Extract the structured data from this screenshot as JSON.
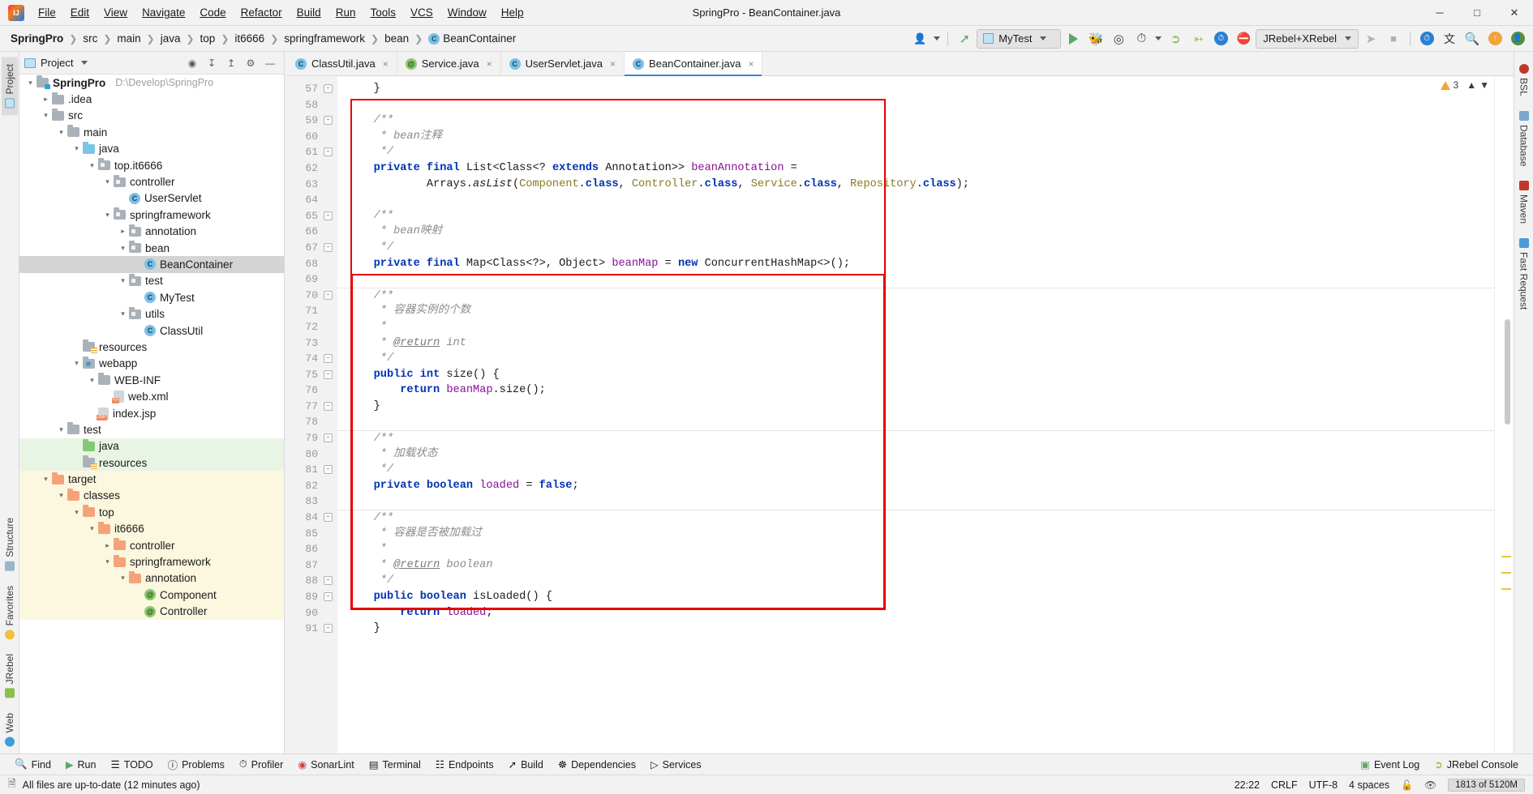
{
  "window": {
    "title": "SpringPro - BeanContainer.java",
    "logo_icon": "intellij-idea-logo",
    "minimize_icon": "minimize-icon",
    "maximize_icon": "maximize-icon",
    "close_icon": "close-icon"
  },
  "menubar": [
    {
      "label": "File"
    },
    {
      "label": "Edit"
    },
    {
      "label": "View"
    },
    {
      "label": "Navigate"
    },
    {
      "label": "Code"
    },
    {
      "label": "Refactor"
    },
    {
      "label": "Build"
    },
    {
      "label": "Run"
    },
    {
      "label": "Tools"
    },
    {
      "label": "VCS"
    },
    {
      "label": "Window"
    },
    {
      "label": "Help"
    }
  ],
  "breadcrumbs": [
    {
      "label": "SpringPro",
      "bold": true
    },
    {
      "label": "src"
    },
    {
      "label": "main"
    },
    {
      "label": "java"
    },
    {
      "label": "top"
    },
    {
      "label": "it6666"
    },
    {
      "label": "springframework"
    },
    {
      "label": "bean"
    },
    {
      "label": "BeanContainer",
      "icon": "class-icon",
      "badge": "C"
    }
  ],
  "toolbar": {
    "user_icon": "user-avatar-icon",
    "build_icon": "build-hammer-icon",
    "run_config": {
      "label": "MyTest",
      "icon": "run-config-icon",
      "chevron": "chevron-down-icon"
    },
    "run_icon": "run-play-icon",
    "debug_icon": "debug-bug-icon",
    "run_coverage_icon": "run-with-coverage-icon",
    "profiler_icon": "profiler-clock-icon",
    "profiler_chevron": "chevron-down-icon",
    "jrebel_run_icon": "jrebel-run-icon",
    "jrebel_debug_icon": "jrebel-debug-icon",
    "xrebel_icon": "xrebel-icon",
    "stop_rebel_icon": "jrebel-stop-icon",
    "jrebel_select": {
      "label": "JRebel+XRebel",
      "chevron": "chevron-down-icon"
    },
    "attach_icon": "attach-profiler-icon",
    "stop_icon": "stop-square-icon",
    "xrebel_globe_icon": "xrebel-globe-icon",
    "translate_icon": "translate-icon",
    "search_icon": "search-everywhere-icon",
    "update_icon": "update-arrow-icon",
    "avatar_icon": "user-account-avatar"
  },
  "left_rail": [
    {
      "label": "Project",
      "icon": "project-panel-icon",
      "active": true
    },
    {
      "label": "Structure",
      "icon": "structure-panel-icon",
      "active": false
    },
    {
      "label": "Favorites",
      "icon": "favorites-star-icon",
      "active": false
    },
    {
      "label": "JRebel",
      "icon": "jrebel-panel-icon",
      "active": false
    },
    {
      "label": "Web",
      "icon": "web-panel-icon",
      "active": false
    }
  ],
  "right_rail": [
    {
      "label": "BSL",
      "icon": "bsl-panel-icon"
    },
    {
      "label": "Database",
      "icon": "database-panel-icon"
    },
    {
      "label": "Maven",
      "icon": "maven-panel-icon"
    },
    {
      "label": "Fast Request",
      "icon": "fast-request-panel-icon"
    }
  ],
  "project_panel": {
    "title": "Project",
    "title_chevron": "chevron-down-icon",
    "locate_icon": "scroll-from-source-icon",
    "expand_icon": "expand-all-icon",
    "collapse_icon": "collapse-all-icon",
    "settings_icon": "gear-icon",
    "hide_icon": "hide-panel-icon",
    "tree": [
      {
        "indent": 0,
        "arrow": "v",
        "icon": "module-folder",
        "name": "SpringPro",
        "bold": true,
        "path": "D:\\Develop\\SpringPro",
        "state": "normal"
      },
      {
        "indent": 1,
        "arrow": ">",
        "icon": "folder-grey",
        "name": ".idea",
        "state": "normal"
      },
      {
        "indent": 1,
        "arrow": "v",
        "icon": "folder-grey",
        "name": "src",
        "state": "normal"
      },
      {
        "indent": 2,
        "arrow": "v",
        "icon": "folder-grey",
        "name": "main",
        "state": "normal"
      },
      {
        "indent": 3,
        "arrow": "v",
        "icon": "folder-src",
        "name": "java",
        "state": "normal"
      },
      {
        "indent": 4,
        "arrow": "v",
        "icon": "package",
        "name": "top.it6666",
        "state": "normal"
      },
      {
        "indent": 5,
        "arrow": "v",
        "icon": "package",
        "name": "controller",
        "state": "normal"
      },
      {
        "indent": 6,
        "arrow": "",
        "icon": "class",
        "name": "UserServlet",
        "state": "normal"
      },
      {
        "indent": 5,
        "arrow": "v",
        "icon": "package",
        "name": "springframework",
        "state": "normal"
      },
      {
        "indent": 6,
        "arrow": ">",
        "icon": "package",
        "name": "annotation",
        "state": "normal"
      },
      {
        "indent": 6,
        "arrow": "v",
        "icon": "package",
        "name": "bean",
        "state": "normal"
      },
      {
        "indent": 7,
        "arrow": "",
        "icon": "class",
        "name": "BeanContainer",
        "state": "selected"
      },
      {
        "indent": 6,
        "arrow": "v",
        "icon": "package",
        "name": "test",
        "state": "normal"
      },
      {
        "indent": 7,
        "arrow": "",
        "icon": "class-runnable",
        "name": "MyTest",
        "state": "normal"
      },
      {
        "indent": 6,
        "arrow": "v",
        "icon": "package",
        "name": "utils",
        "state": "normal"
      },
      {
        "indent": 7,
        "arrow": "",
        "icon": "class",
        "name": "ClassUtil",
        "state": "normal"
      },
      {
        "indent": 3,
        "arrow": "",
        "icon": "folder-resources",
        "name": "resources",
        "state": "normal"
      },
      {
        "indent": 3,
        "arrow": "v",
        "icon": "folder-webapp",
        "name": "webapp",
        "state": "normal"
      },
      {
        "indent": 4,
        "arrow": "v",
        "icon": "folder-grey",
        "name": "WEB-INF",
        "state": "normal"
      },
      {
        "indent": 5,
        "arrow": "",
        "icon": "file-xml",
        "name": "web.xml",
        "state": "normal"
      },
      {
        "indent": 4,
        "arrow": "",
        "icon": "file-jsp",
        "name": "index.jsp",
        "state": "normal"
      },
      {
        "indent": 2,
        "arrow": "v",
        "icon": "folder-grey",
        "name": "test",
        "state": "normal"
      },
      {
        "indent": 3,
        "arrow": "",
        "icon": "folder-test-src",
        "name": "java",
        "state": "green"
      },
      {
        "indent": 3,
        "arrow": "",
        "icon": "folder-test-res",
        "name": "resources",
        "state": "green"
      },
      {
        "indent": 1,
        "arrow": "v",
        "icon": "folder-orange",
        "name": "target",
        "state": "yellow"
      },
      {
        "indent": 2,
        "arrow": "v",
        "icon": "folder-orange",
        "name": "classes",
        "state": "yellow"
      },
      {
        "indent": 3,
        "arrow": "v",
        "icon": "folder-orange",
        "name": "top",
        "state": "yellow"
      },
      {
        "indent": 4,
        "arrow": "v",
        "icon": "folder-orange",
        "name": "it6666",
        "state": "yellow"
      },
      {
        "indent": 5,
        "arrow": ">",
        "icon": "folder-orange",
        "name": "controller",
        "state": "yellow"
      },
      {
        "indent": 5,
        "arrow": "v",
        "icon": "folder-orange",
        "name": "springframework",
        "state": "yellow"
      },
      {
        "indent": 6,
        "arrow": "v",
        "icon": "folder-orange",
        "name": "annotation",
        "state": "yellow"
      },
      {
        "indent": 7,
        "arrow": "",
        "icon": "annotation",
        "name": "Component",
        "state": "yellow"
      },
      {
        "indent": 7,
        "arrow": "",
        "icon": "annotation",
        "name": "Controller",
        "state": "yellow"
      }
    ]
  },
  "tabs": [
    {
      "label": "ClassUtil.java",
      "icon": "class-icon",
      "badge": "C",
      "active": false,
      "close": "×"
    },
    {
      "label": "Service.java",
      "icon": "annotation-icon",
      "badge": "@",
      "active": false,
      "close": "×"
    },
    {
      "label": "UserServlet.java",
      "icon": "class-icon",
      "badge": "C",
      "active": false,
      "close": "×"
    },
    {
      "label": "BeanContainer.java",
      "icon": "class-icon",
      "badge": "C",
      "active": true,
      "close": "×"
    }
  ],
  "editor": {
    "first_line": 57,
    "last_line": 91,
    "inspection": {
      "count": "3",
      "icon": "warning-triangle-icon",
      "up": "⌃",
      "down": "⌄"
    },
    "fold_lines": [
      57,
      59,
      61,
      65,
      67,
      70,
      74,
      75,
      77,
      79,
      81,
      84,
      88,
      89,
      91
    ],
    "lines": [
      {
        "n": 57,
        "fold": "-",
        "html": "    <span class=\"p\">}</span>"
      },
      {
        "n": 58,
        "fold": "",
        "html": ""
      },
      {
        "n": 59,
        "fold": "-",
        "html": "    <span class=\"cmt\">/**</span>"
      },
      {
        "n": 60,
        "fold": "",
        "html": "     <span class=\"cmt\">* bean注释</span>"
      },
      {
        "n": 61,
        "fold": "-",
        "html": "     <span class=\"cmt\">*/</span>"
      },
      {
        "n": 62,
        "fold": "",
        "html": "    <span class=\"k\">private</span> <span class=\"k\">final</span> List&lt;Class&lt;? <span class=\"k\">extends</span> Annotation&gt;&gt; <span class=\"fld\">beanAnnotation</span> ="
      },
      {
        "n": 63,
        "fold": "",
        "html": "            Arrays.<span class=\"stat\">asList</span>(<span class=\"cls-ref\">Component</span>.<span class=\"k\">class</span>, <span class=\"cls-ref\">Controller</span>.<span class=\"k\">class</span>, <span class=\"cls-ref\">Service</span>.<span class=\"k\">class</span>, <span class=\"cls-ref\">Repository</span>.<span class=\"k\">class</span>);"
      },
      {
        "n": 64,
        "fold": "",
        "html": ""
      },
      {
        "n": 65,
        "fold": "-",
        "html": "    <span class=\"cmt\">/**</span>"
      },
      {
        "n": 66,
        "fold": "",
        "html": "     <span class=\"cmt\">* bean映射</span>"
      },
      {
        "n": 67,
        "fold": "-",
        "html": "     <span class=\"cmt\">*/</span>"
      },
      {
        "n": 68,
        "fold": "",
        "html": "    <span class=\"k\">private</span> <span class=\"k\">final</span> Map&lt;Class&lt;?&gt;, Object&gt; <span class=\"fld\">beanMap</span> = <span class=\"k\">new</span> ConcurrentHashMap&lt;&gt;();"
      },
      {
        "n": 69,
        "fold": "",
        "html": ""
      },
      {
        "n": 70,
        "fold": "-",
        "html": "    <span class=\"cmt\">/**</span>",
        "sep": true
      },
      {
        "n": 71,
        "fold": "",
        "html": "     <span class=\"cmt\">* 容器实例的个数</span>"
      },
      {
        "n": 72,
        "fold": "",
        "html": "     <span class=\"cmt\">*</span>"
      },
      {
        "n": 73,
        "fold": "",
        "html": "     <span class=\"cmt\">* <span class=\"tagdoc\">@return</span> int</span>"
      },
      {
        "n": 74,
        "fold": "-",
        "html": "     <span class=\"cmt\">*/</span>"
      },
      {
        "n": 75,
        "fold": "-",
        "html": "    <span class=\"k\">public</span> <span class=\"k\">int</span> size() {"
      },
      {
        "n": 76,
        "fold": "",
        "html": "        <span class=\"k\">return</span> <span class=\"fld\">beanMap</span>.size();"
      },
      {
        "n": 77,
        "fold": "-",
        "html": "    }"
      },
      {
        "n": 78,
        "fold": "",
        "html": ""
      },
      {
        "n": 79,
        "fold": "-",
        "html": "    <span class=\"cmt\">/**</span>",
        "sep": true
      },
      {
        "n": 80,
        "fold": "",
        "html": "     <span class=\"cmt\">* 加载状态</span>"
      },
      {
        "n": 81,
        "fold": "-",
        "html": "     <span class=\"cmt\">*/</span>"
      },
      {
        "n": 82,
        "fold": "",
        "html": "    <span class=\"k\">private</span> <span class=\"k\">boolean</span> <span class=\"fld\">loaded</span> = <span class=\"k\">false</span>;"
      },
      {
        "n": 83,
        "fold": "",
        "html": ""
      },
      {
        "n": 84,
        "fold": "-",
        "html": "    <span class=\"cmt\">/**</span>",
        "sep": true
      },
      {
        "n": 85,
        "fold": "",
        "html": "     <span class=\"cmt\">* 容器是否被加载过</span>"
      },
      {
        "n": 86,
        "fold": "",
        "html": "     <span class=\"cmt\">*</span>"
      },
      {
        "n": 87,
        "fold": "",
        "html": "     <span class=\"cmt\">* <span class=\"tagdoc\">@return</span> boolean</span>"
      },
      {
        "n": 88,
        "fold": "-",
        "html": "     <span class=\"cmt\">*/</span>"
      },
      {
        "n": 89,
        "fold": "-",
        "html": "    <span class=\"k\">public</span> <span class=\"k\">boolean</span> isLoaded() {"
      },
      {
        "n": 90,
        "fold": "",
        "html": "        <span class=\"k\">return</span> <span class=\"fld\">loaded</span>;"
      },
      {
        "n": 91,
        "fold": "-",
        "html": "    }"
      }
    ],
    "annotation_color": "#e60000"
  },
  "tool_windows": [
    {
      "label": "Find",
      "icon": "search-icon"
    },
    {
      "label": "Run",
      "icon": "run-play-icon"
    },
    {
      "label": "TODO",
      "icon": "todo-list-icon"
    },
    {
      "label": "Problems",
      "icon": "problems-icon"
    },
    {
      "label": "Profiler",
      "icon": "profiler-icon"
    },
    {
      "label": "SonarLint",
      "icon": "sonarlint-icon"
    },
    {
      "label": "Terminal",
      "icon": "terminal-icon"
    },
    {
      "label": "Endpoints",
      "icon": "endpoints-icon"
    },
    {
      "label": "Build",
      "icon": "build-hammer-icon"
    },
    {
      "label": "Dependencies",
      "icon": "dependencies-icon"
    },
    {
      "label": "Services",
      "icon": "services-icon"
    }
  ],
  "tool_windows_right": [
    {
      "label": "Event Log",
      "icon": "event-log-icon"
    },
    {
      "label": "JRebel Console",
      "icon": "jrebel-console-icon"
    }
  ],
  "statusbar": {
    "message": "All files are up-to-date (12 minutes ago)",
    "message_icon": "status-doc-icon",
    "position": "22:22",
    "line_separator": "CRLF",
    "encoding": "UTF-8",
    "indent": "4 spaces",
    "lock_icon": "read-write-lock-icon",
    "inspection_icon": "inspection-eye-icon",
    "memory": "1813 of 5120M"
  },
  "colors": {
    "accent_blue": "#3b86d0",
    "highlight_red": "#e60000",
    "green_scope": "#e9f5e4",
    "yellow_scope": "#fbf8df",
    "selection_grey": "#d4d4d4"
  }
}
